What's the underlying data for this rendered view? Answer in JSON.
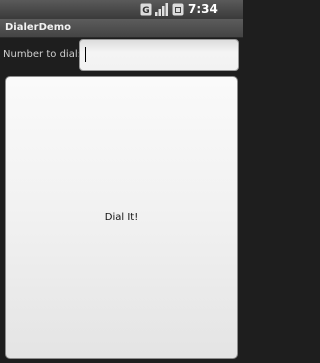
{
  "status_bar": {
    "time": "7:34 PM",
    "icons": [
      "network-type-icon",
      "signal-strength-icon",
      "battery-icon"
    ]
  },
  "title_bar": {
    "title": "DialerDemo"
  },
  "form": {
    "number_label": "Number to dial:",
    "number_value": "",
    "number_placeholder": ""
  },
  "dial_button": {
    "label": "Dial It!"
  }
}
